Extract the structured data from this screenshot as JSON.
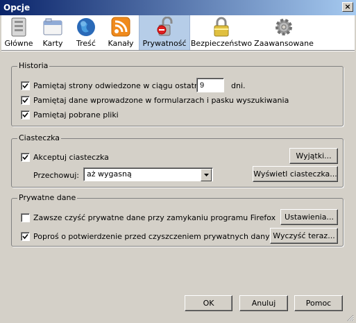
{
  "window": {
    "title": "Opcje",
    "close_glyph": "×"
  },
  "toolbar": {
    "items": [
      {
        "label": "Główne",
        "icon": "switch-panel-icon"
      },
      {
        "label": "Karty",
        "icon": "tabs-window-icon"
      },
      {
        "label": "Treść",
        "icon": "globe-icon"
      },
      {
        "label": "Kanały",
        "icon": "rss-feed-icon"
      },
      {
        "label": "Prywatność",
        "icon": "privacy-lock-icon",
        "active": true
      },
      {
        "label": "Bezpieczeństwo",
        "icon": "padlock-icon"
      },
      {
        "label": "Zaawansowane",
        "icon": "gear-icon"
      }
    ]
  },
  "history": {
    "legend": "Historia",
    "remember_pages_pre": "Pamiętaj strony odwiedzone w ciągu ostatnich",
    "days_value": "9",
    "days_suffix": "dni.",
    "remember_forms": "Pamiętaj dane wprowadzone w formularzach i pasku wyszukiwania",
    "remember_downloads": "Pamiętaj pobrane pliki"
  },
  "cookies": {
    "legend": "Ciasteczka",
    "accept": "Akceptuj ciasteczka",
    "exceptions_button": "Wyjątki...",
    "keep_label": "Przechowuj:",
    "keep_value": "aż wygasną",
    "show_button": "Wyświetl ciasteczka..."
  },
  "private_data": {
    "legend": "Prywatne dane",
    "always_clear": "Zawsze czyść prywatne dane przy zamykaniu programu Firefox",
    "settings_button": "Ustawienia...",
    "ask_confirm": "Poproś o potwierdzenie przed czyszczeniem prywatnych danych",
    "clear_now_button": "Wyczyść teraz..."
  },
  "footer": {
    "ok": "OK",
    "cancel": "Anuluj",
    "help": "Pomoc"
  },
  "colors": {
    "titlebar_start": "#0a246a",
    "titlebar_end": "#a6caf0",
    "active_tab": "#b6cde8",
    "dialog_bg": "#d4d0c8"
  }
}
